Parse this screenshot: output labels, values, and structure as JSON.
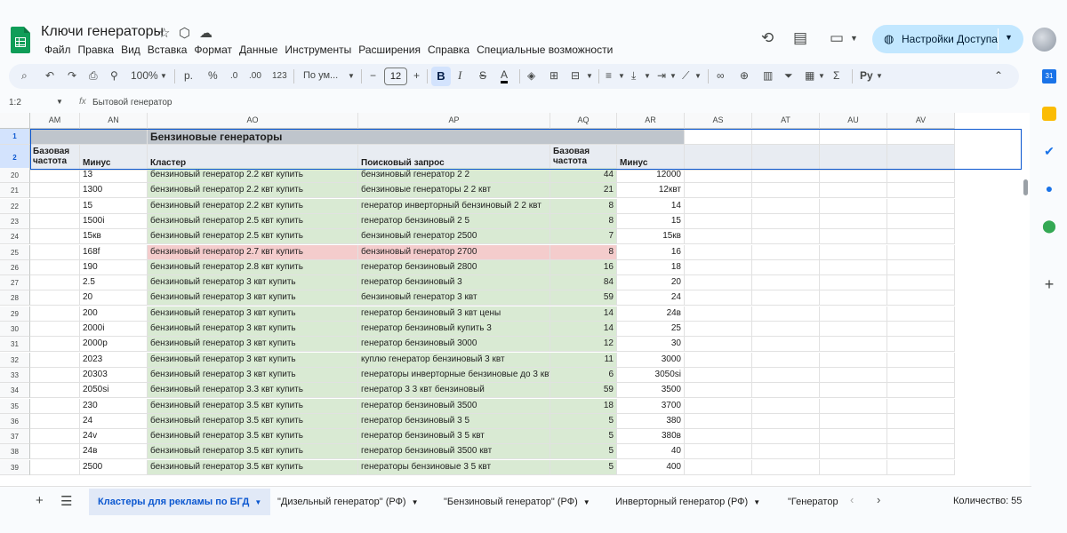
{
  "header": {
    "title": "Ключи генераторы",
    "menu": [
      "Файл",
      "Правка",
      "Вид",
      "Вставка",
      "Формат",
      "Данные",
      "Инструменты",
      "Расширения",
      "Справка",
      "Специальные возможности"
    ],
    "share_label": "Настройки Доступа"
  },
  "toolbar": {
    "zoom": "100%",
    "currency": "р.",
    "percent": "%",
    "decrease_decimals": ".0",
    "increase_decimals": ".00",
    "format_123": "123",
    "font": "По ум...",
    "font_size": "12",
    "bold": "B",
    "italic": "I",
    "strike": "S",
    "text_color": "A",
    "sigma": "Σ",
    "input_tools": "Ру"
  },
  "formula_bar": {
    "cell_ref": "1:2",
    "fx": "fx",
    "value": "Бытовой генератор"
  },
  "grid": {
    "columns": [
      "AM",
      "AN",
      "AO",
      "AP",
      "AQ",
      "AR",
      "AS",
      "AT",
      "AU",
      "AV"
    ],
    "title_row": {
      "number": "1",
      "text": "Бензиновые генераторы"
    },
    "header_row": {
      "number": "2",
      "base_freq_1a": "Базовая",
      "base_freq_1b": "частота",
      "minus_1": "Минус",
      "cluster": "Кластер",
      "query": "Поисковый запрос",
      "base_freq_2a": "Базовая",
      "base_freq_2b": "частота",
      "minus_2": "Минус"
    },
    "rows": [
      {
        "n": "20",
        "minus": "13",
        "cluster": "бензиновый генератор 2.2 квт купить",
        "query": "бензиновый генератор 2 2",
        "freq": "44",
        "minus2": "12000",
        "hl": "green"
      },
      {
        "n": "21",
        "minus": "1300",
        "cluster": "бензиновый генератор 2.2 квт купить",
        "query": "бензиновые генераторы 2 2 квт",
        "freq": "21",
        "minus2": "12квт",
        "hl": "green"
      },
      {
        "n": "22",
        "minus": "15",
        "cluster": "бензиновый генератор 2.2 квт купить",
        "query": "генератор инверторный бензиновый 2 2 квт",
        "freq": "8",
        "minus2": "14",
        "hl": "green"
      },
      {
        "n": "23",
        "minus": "1500i",
        "cluster": "бензиновый генератор 2.5 квт купить",
        "query": "генератор бензиновый 2 5",
        "freq": "8",
        "minus2": "15",
        "hl": "green"
      },
      {
        "n": "24",
        "minus": "15кв",
        "cluster": "бензиновый генератор 2.5 квт купить",
        "query": "бензиновый генератор 2500",
        "freq": "7",
        "minus2": "15кв",
        "hl": "green"
      },
      {
        "n": "25",
        "minus": "168f",
        "cluster": "бензиновый генератор 2.7 квт купить",
        "query": "бензиновый генератор 2700",
        "freq": "8",
        "minus2": "16",
        "hl": "pink"
      },
      {
        "n": "26",
        "minus": "190",
        "cluster": "бензиновый генератор 2.8 квт купить",
        "query": "генератор бензиновый 2800",
        "freq": "16",
        "minus2": "18",
        "hl": "green"
      },
      {
        "n": "27",
        "minus": "2.5",
        "cluster": "бензиновый генератор 3 квт купить",
        "query": "генератор бензиновый 3",
        "freq": "84",
        "minus2": "20",
        "hl": "green"
      },
      {
        "n": "28",
        "minus": "20",
        "cluster": "бензиновый генератор 3 квт купить",
        "query": "бензиновый генератор 3 квт",
        "freq": "59",
        "minus2": "24",
        "hl": "green"
      },
      {
        "n": "29",
        "minus": "200",
        "cluster": "бензиновый генератор 3 квт купить",
        "query": "генератор бензиновый 3 квт цены",
        "freq": "14",
        "minus2": "24в",
        "hl": "green"
      },
      {
        "n": "30",
        "minus": "2000i",
        "cluster": "бензиновый генератор 3 квт купить",
        "query": "генератор бензиновый купить 3",
        "freq": "14",
        "minus2": "25",
        "hl": "green"
      },
      {
        "n": "31",
        "minus": "2000p",
        "cluster": "бензиновый генератор 3 квт купить",
        "query": "генератор бензиновый 3000",
        "freq": "12",
        "minus2": "30",
        "hl": "green"
      },
      {
        "n": "32",
        "minus": "2023",
        "cluster": "бензиновый генератор 3 квт купить",
        "query": "куплю генератор бензиновый 3 квт",
        "freq": "11",
        "minus2": "3000",
        "hl": "green"
      },
      {
        "n": "33",
        "minus": "20303",
        "cluster": "бензиновый генератор 3 квт купить",
        "query": "генераторы инверторные бензиновые до 3 квт",
        "freq": "6",
        "minus2": "3050si",
        "hl": "green"
      },
      {
        "n": "34",
        "minus": "2050si",
        "cluster": "бензиновый генератор 3.3 квт купить",
        "query": "генератор 3 3 квт бензиновый",
        "freq": "59",
        "minus2": "3500",
        "hl": "green"
      },
      {
        "n": "35",
        "minus": "230",
        "cluster": "бензиновый генератор 3.5 квт купить",
        "query": "генератор бензиновый 3500",
        "freq": "18",
        "minus2": "3700",
        "hl": "green"
      },
      {
        "n": "36",
        "minus": "24",
        "cluster": "бензиновый генератор 3.5 квт купить",
        "query": "генератор бензиновый 3 5",
        "freq": "5",
        "minus2": "380",
        "hl": "green"
      },
      {
        "n": "37",
        "minus": "24v",
        "cluster": "бензиновый генератор 3.5 квт купить",
        "query": "генератор бензиновый 3 5 квт",
        "freq": "5",
        "minus2": "380в",
        "hl": "green"
      },
      {
        "n": "38",
        "minus": "24в",
        "cluster": "бензиновый генератор 3.5 квт купить",
        "query": "генератор бензиновый 3500 квт",
        "freq": "5",
        "minus2": "40",
        "hl": "green"
      },
      {
        "n": "39",
        "minus": "2500",
        "cluster": "бензиновый генератор 3.5 квт купить",
        "query": "генераторы бензиновые 3 5 квт",
        "freq": "5",
        "minus2": "400",
        "hl": "green"
      }
    ]
  },
  "tabs": [
    {
      "label": "Кластеры для рекламы по БГД",
      "active": true
    },
    {
      "label": "\"Дизельный генератор\" (РФ)",
      "active": false
    },
    {
      "label": "\"Бензиновый генератор\" (РФ)",
      "active": false
    },
    {
      "label": "Инверторный генератор (РФ)",
      "active": false
    },
    {
      "label": "\"Генератор",
      "active": false
    }
  ],
  "status": {
    "count": "Количество: 55"
  },
  "colors": {
    "accent": "#0b57d0",
    "green_fill": "#d9ead3",
    "pink_fill": "#f4cccc",
    "share_bg": "#c2e7ff"
  },
  "icons": {
    "side": [
      "calendar-icon",
      "keep-icon",
      "tasks-icon",
      "contacts-icon",
      "maps-icon",
      "add-icon"
    ]
  }
}
